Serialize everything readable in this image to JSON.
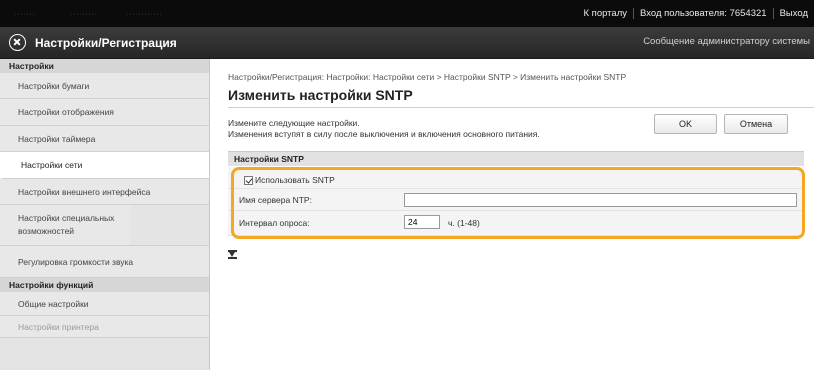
{
  "topbar": {
    "blurred_left": [
      "ᐧᐧᐧᐧᐧᐧᐧ",
      "ᐧᐧᐧᐧᐧᐧᐧᐧᐧ",
      "ᐧᐧᐧᐧᐧᐧᐧᐧᐧᐧᐧᐧ"
    ],
    "portal_link": "К порталу",
    "login_label": "Вход пользователя:",
    "user_id": "7654321",
    "logout_link": "Выход"
  },
  "header": {
    "logo_icon": "canon-remote-ui-icon",
    "title": "Настройки/Регистрация",
    "admin_message": "Сообщение администратору системы"
  },
  "sidebar": {
    "section_settings": "Настройки",
    "items": [
      {
        "label": "Настройки бумаги"
      },
      {
        "label": "Настройки отображения"
      },
      {
        "label": "Настройки таймера"
      },
      {
        "label": "Настройки сети"
      },
      {
        "label": "Настройки внешнего интерфейса"
      },
      {
        "label": "Настройки специальных возможностей"
      },
      {
        "label": "Регулировка громкости звука"
      }
    ],
    "section_functions": "Настройки функций",
    "func_items": [
      {
        "label": "Общие настройки"
      },
      {
        "label": "Настройки принтера"
      }
    ],
    "active_index": 3
  },
  "main": {
    "breadcrumb": "Настройки/Регистрация: Настройки: Настройки сети > Настройки SNTP > Изменить настройки SNTP",
    "page_title": "Изменить настройки SNTP",
    "description_1": "Измените следующие настройки.",
    "description_2": "Изменения вступят в силу после выключения и включения основного питания.",
    "ok_button": "OK",
    "cancel_button": "Отмена",
    "section_title": "Настройки SNTP",
    "use_sntp_label": "Использовать SNTP",
    "use_sntp_checked": true,
    "ntp_server_label": "Имя сервера NTP:",
    "ntp_server_value": "",
    "poll_interval_label": "Интервал опроса:",
    "poll_interval_value": "24",
    "poll_interval_unit": "ч. (1-48)",
    "highlight_color": "#f5a623",
    "back_to_top_icon": "back-to-top-icon"
  }
}
